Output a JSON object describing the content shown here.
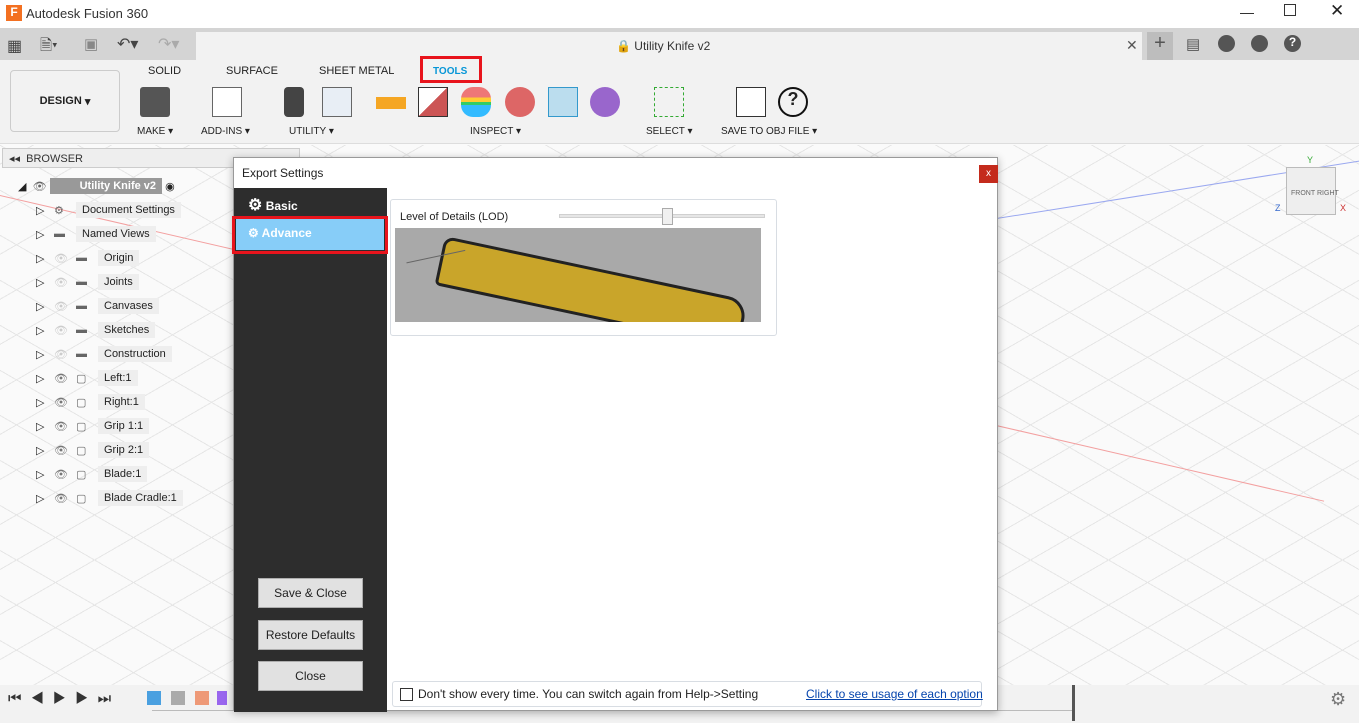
{
  "window": {
    "title": "Autodesk Fusion 360",
    "app_icon": "F"
  },
  "document": {
    "title": "Utility Knife v2"
  },
  "ribbon": {
    "workspace": "DESIGN",
    "tabs": [
      "SOLID",
      "SURFACE",
      "SHEET METAL",
      "TOOLS"
    ],
    "active_tab": "TOOLS",
    "groups": [
      "MAKE",
      "ADD-INS",
      "UTILITY",
      "INSPECT",
      "SELECT",
      "SAVE TO OBJ FILE"
    ]
  },
  "browser": {
    "title": "BROWSER",
    "root": "Utility Knife v2",
    "items": [
      "Document Settings",
      "Named Views",
      "Origin",
      "Joints",
      "Canvases",
      "Sketches",
      "Construction",
      "Left:1",
      "Right:1",
      "Grip 1:1",
      "Grip 2:1",
      "Blade:1",
      "Blade Cradle:1"
    ]
  },
  "viewcube": {
    "front": "FRONT",
    "right": "RIGHT",
    "x": "X",
    "y": "Y",
    "z": "Z"
  },
  "dialog": {
    "title": "Export Settings",
    "close": "x",
    "nav": [
      {
        "label": "Basic"
      },
      {
        "label": "Advance",
        "selected": true
      }
    ],
    "lod_label": "Level of Details (LOD)",
    "lod_value": 0.5,
    "buttons": [
      "Save & Close",
      "Restore Defaults",
      "Close"
    ],
    "dont_show": "Don't show every time. You can switch again from Help->Setting",
    "dont_show_checked": false,
    "help_link": "Click to see usage of each option"
  },
  "colors": {
    "highlight": "#e8141c",
    "accent": "#0696d7",
    "selected_nav": "#87cdf8",
    "dialog_sidebar": "#2d2d2d"
  }
}
